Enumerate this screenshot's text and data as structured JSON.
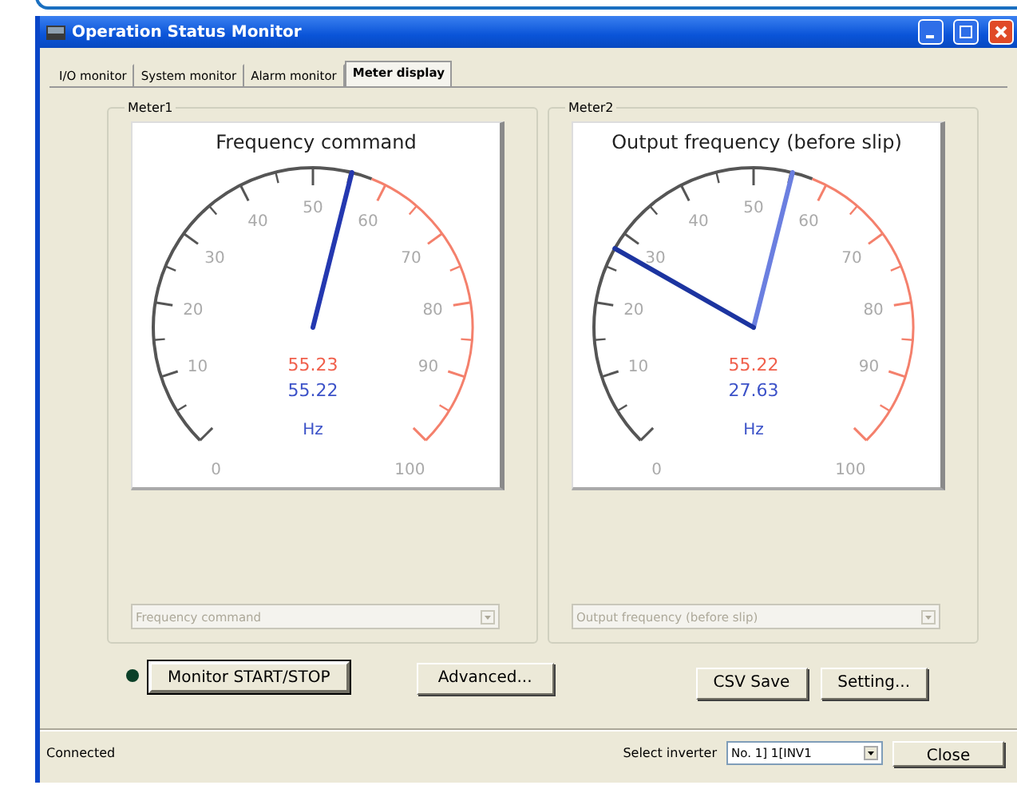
{
  "window": {
    "title": "Operation Status Monitor"
  },
  "tabs": [
    {
      "label": "I/O monitor",
      "selected": false
    },
    {
      "label": "System monitor",
      "selected": false
    },
    {
      "label": "Alarm monitor",
      "selected": false
    },
    {
      "label": "Meter display",
      "selected": true
    }
  ],
  "meters": [
    {
      "group": "Meter1",
      "title": "Frequency command",
      "scale_labels": [
        "0",
        "10",
        "20",
        "30",
        "40",
        "50",
        "60",
        "70",
        "80",
        "90",
        "100"
      ],
      "needles": [
        {
          "level": 0.5522,
          "color": "#2438b0"
        }
      ],
      "readings": [
        {
          "text": "55.23",
          "color": "#f0604c"
        },
        {
          "text": "55.22",
          "color": "#3c52c8"
        }
      ],
      "unit": "Hz",
      "selector": {
        "value": "Frequency command",
        "disabled": true
      }
    },
    {
      "group": "Meter2",
      "title": "Output frequency (before slip)",
      "scale_labels": [
        "0",
        "10",
        "20",
        "30",
        "40",
        "50",
        "60",
        "70",
        "80",
        "90",
        "100"
      ],
      "needles": [
        {
          "level": 0.5522,
          "color": "#6b7fe0"
        },
        {
          "level": 0.2763,
          "color": "#1c34a0"
        }
      ],
      "readings": [
        {
          "text": "55.22",
          "color": "#f0604c"
        },
        {
          "text": "27.63",
          "color": "#3c52c8"
        }
      ],
      "unit": "Hz",
      "selector": {
        "value": "Output frequency (before slip)",
        "disabled": true
      }
    }
  ],
  "status_led": {
    "on": false
  },
  "buttons_left": [
    {
      "label": "Monitor START/STOP",
      "default": true
    },
    {
      "label": "Advanced...",
      "default": false
    }
  ],
  "buttons_right": [
    {
      "label": "CSV Save",
      "default": false
    },
    {
      "label": "Setting...",
      "default": false
    }
  ],
  "status_bar": {
    "status": "Connected",
    "inverter_label": "Select inverter",
    "inverter_value": "No. 1] 1[INV1",
    "close_button": "Close"
  }
}
